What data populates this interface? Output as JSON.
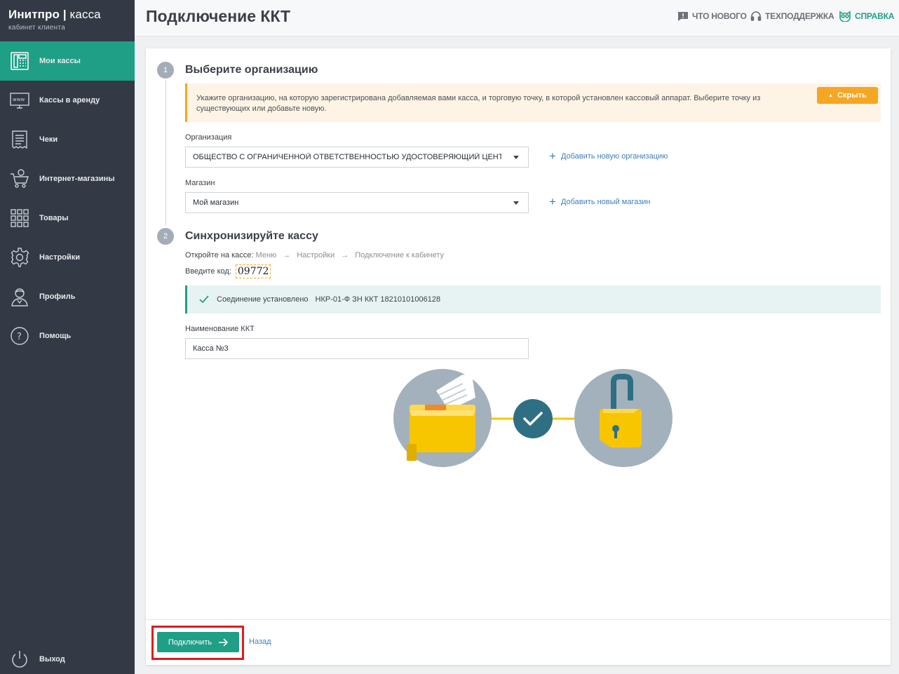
{
  "brand": {
    "name_bold": "Инитпро",
    "name_light": "касса",
    "separator": "|",
    "subtitle": "кабинет клиента"
  },
  "sidebar": {
    "items": [
      {
        "label": "Мои кассы",
        "icon": "cash-register-icon",
        "active": true
      },
      {
        "label": "Кассы в аренду",
        "icon": "www-monitor-icon",
        "active": false
      },
      {
        "label": "Чеки",
        "icon": "receipt-icon",
        "active": false
      },
      {
        "label": "Интернет-магазины",
        "icon": "shopping-cart-icon",
        "active": false
      },
      {
        "label": "Товары",
        "icon": "grid-icon",
        "active": false
      },
      {
        "label": "Настройки",
        "icon": "gear-icon",
        "active": false
      },
      {
        "label": "Профиль",
        "icon": "user-icon",
        "active": false
      },
      {
        "label": "Помощь",
        "icon": "help-circle-icon",
        "active": false
      }
    ],
    "logout": {
      "label": "Выход",
      "icon": "power-icon"
    }
  },
  "header": {
    "title": "Подключение ККТ",
    "links": {
      "whats_new": "ЧТО НОВОГО",
      "support": "ТЕХПОДДЕРЖКА",
      "help": "СПРАВКА"
    }
  },
  "step1": {
    "number": "1",
    "title": "Выберите организацию",
    "notice": "Укажите организацию, на которую зарегистрирована добавляемая вами касса, и торговую точку, в которой установлен кассовый аппарат. Выберите точку из существующих или добавьте новую.",
    "hide_label": "Скрыть",
    "org_label": "Организация",
    "org_value": "ОБЩЕСТВО С ОГРАНИЧЕННОЙ ОТВЕТСТВЕННОСТЬЮ УДОСТОВЕРЯЮЩИЙ ЦЕНТР",
    "add_org": "Добавить новую организацию",
    "shop_label": "Магазин",
    "shop_value": "Мой магазин",
    "add_shop": "Добавить новый магазин"
  },
  "step2": {
    "number": "2",
    "title": "Синхронизируйте кассу",
    "open_label": "Откройте на кассе:",
    "path": [
      "Меню",
      "Настройки",
      "Подключение к кабинету"
    ],
    "path_sep": "→",
    "code_label": "Введите код:",
    "code": "09772",
    "status": "Соединение установлено",
    "device": "НКР-01-Ф ЗН ККТ 18210101006128",
    "name_label": "Наименование ККТ",
    "name_value": "Касса №3"
  },
  "footer": {
    "connect": "Подключить",
    "back": "Назад"
  },
  "colors": {
    "accent": "#1f9f86",
    "warning": "#f5a623",
    "sidebar": "#343a45",
    "link": "#3d7fbf"
  }
}
